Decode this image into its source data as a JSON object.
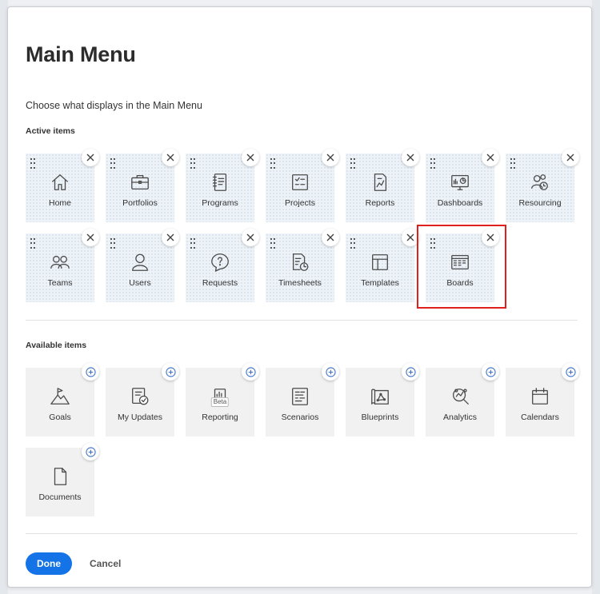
{
  "modal": {
    "title": "Main Menu",
    "subtitle": "Choose what displays in the Main Menu",
    "active_label": "Active items",
    "available_label": "Available items"
  },
  "active_items": [
    {
      "label": "Home",
      "icon": "home-icon"
    },
    {
      "label": "Portfolios",
      "icon": "briefcase-icon"
    },
    {
      "label": "Programs",
      "icon": "notebook-icon"
    },
    {
      "label": "Projects",
      "icon": "checklist-icon"
    },
    {
      "label": "Reports",
      "icon": "report-icon"
    },
    {
      "label": "Dashboards",
      "icon": "dashboard-icon"
    },
    {
      "label": "Resourcing",
      "icon": "resourcing-icon"
    },
    {
      "label": "Teams",
      "icon": "teams-icon"
    },
    {
      "label": "Users",
      "icon": "user-icon"
    },
    {
      "label": "Requests",
      "icon": "request-icon"
    },
    {
      "label": "Timesheets",
      "icon": "timesheet-icon"
    },
    {
      "label": "Templates",
      "icon": "template-icon"
    },
    {
      "label": "Boards",
      "icon": "boards-icon"
    }
  ],
  "available_items": [
    {
      "label": "Goals",
      "icon": "goals-icon"
    },
    {
      "label": "My Updates",
      "icon": "updates-icon"
    },
    {
      "label": "Reporting",
      "icon": "reporting-icon",
      "badge": "Beta"
    },
    {
      "label": "Scenarios",
      "icon": "scenarios-icon"
    },
    {
      "label": "Blueprints",
      "icon": "blueprints-icon"
    },
    {
      "label": "Analytics",
      "icon": "analytics-icon"
    },
    {
      "label": "Calendars",
      "icon": "calendar-icon"
    },
    {
      "label": "Documents",
      "icon": "document-icon"
    }
  ],
  "footer": {
    "done_label": "Done",
    "cancel_label": "Cancel"
  },
  "colors": {
    "primary": "#1473e6",
    "highlight": "#e0201c"
  }
}
